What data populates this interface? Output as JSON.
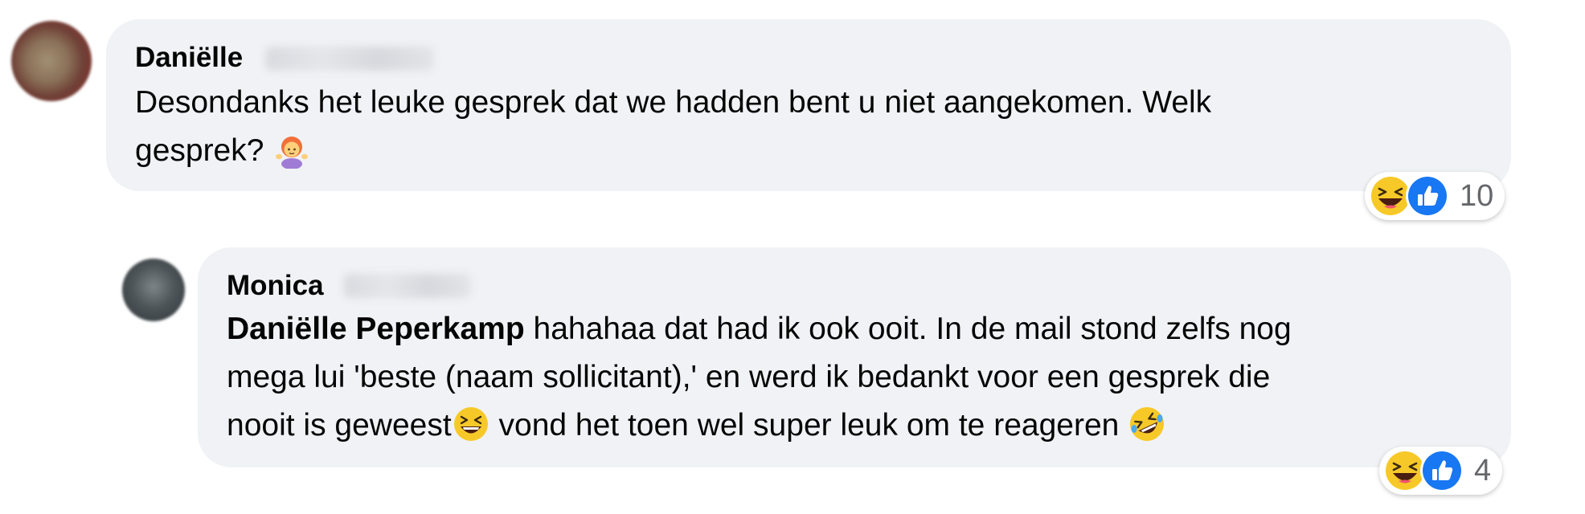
{
  "comments": [
    {
      "author": "Daniëlle",
      "text_lines": [
        "Desondanks het leuke gesprek dat we hadden bent u niet aangekomen. Welk",
        "gesprek? "
      ],
      "reaction_count": "10",
      "reactions": [
        "haha-icon",
        "like-icon"
      ]
    },
    {
      "author": "Monica",
      "mention": "Daniëlle Peperkamp",
      "text_lines": [
        " hahahaa dat had ik ook ooit. In de mail stond zelfs nog",
        "mega lui 'beste (naam sollicitant),' en werd ik bedankt voor een gesprek die",
        "nooit is geweest",
        " vond het toen wel super leuk om te reageren "
      ],
      "reaction_count": "4",
      "reactions": [
        "haha-icon",
        "like-icon"
      ]
    }
  ],
  "colors": {
    "bubble": "#f0f2f5",
    "text": "#050505",
    "count": "#65676b",
    "like_blue": "#1877f2",
    "haha_yellow": "#f7c928"
  }
}
